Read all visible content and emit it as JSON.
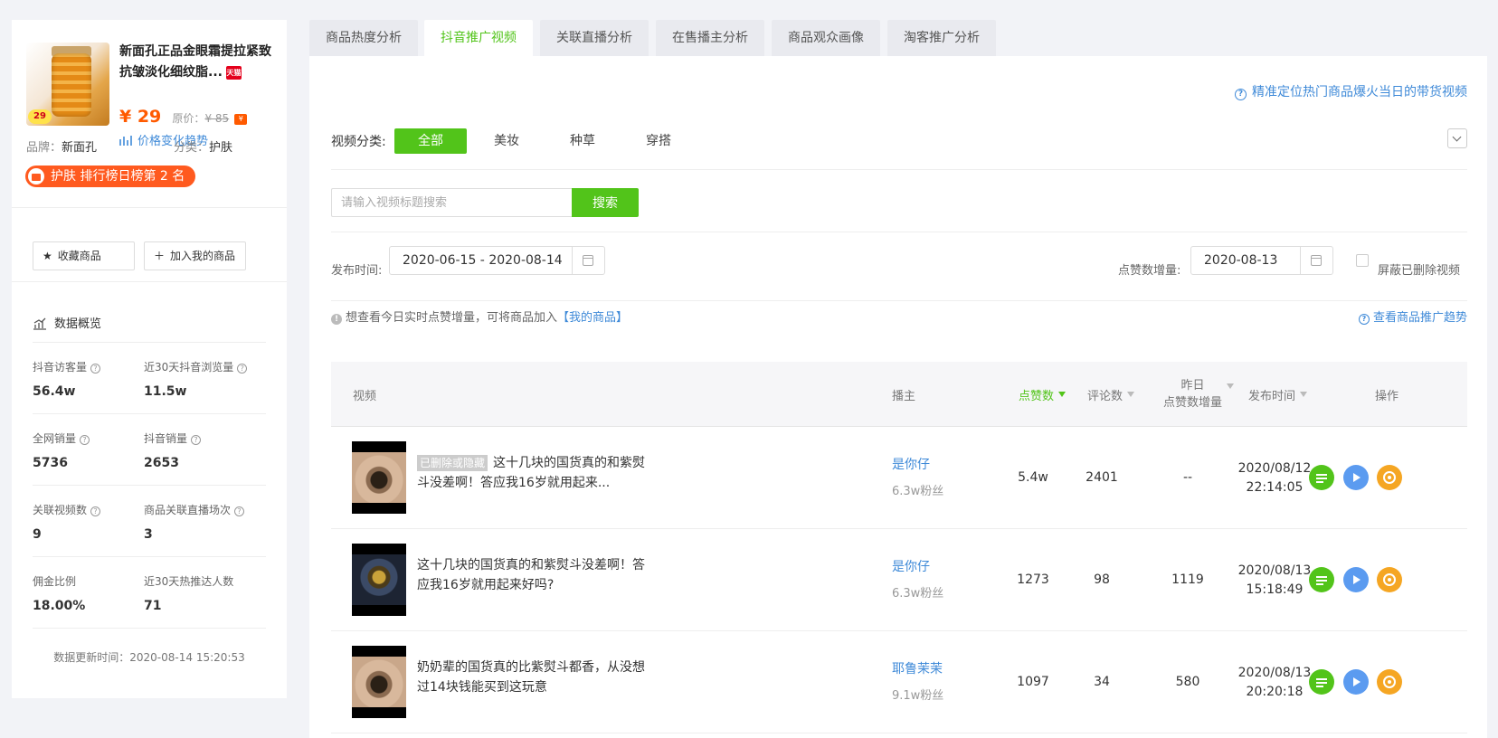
{
  "product": {
    "title": "新面孔正品金眼霜提拉紧致抗皱淡化细纹脂...",
    "tmall_tag": "天猫",
    "price": "¥ 29",
    "orig_price_label": "原价：",
    "orig_price": "¥ 85",
    "small_tag": "¥",
    "image_badge": "29",
    "price_trend_label": "价格变化趋势",
    "brand_label": "品牌：",
    "brand": "新面孔",
    "category_label": "分类：",
    "category": "护肤",
    "rank_badge": "护肤 排行榜日榜第 2 名"
  },
  "actions": {
    "favorite": "收藏商品",
    "add_mine": "加入我的商品"
  },
  "overview": {
    "title": "数据概览",
    "stats": [
      {
        "label": "抖音访客量",
        "value": "56.4w"
      },
      {
        "label": "近30天抖音浏览量",
        "value": "11.5w"
      },
      {
        "label": "全网销量",
        "value": "5736"
      },
      {
        "label": "抖音销量",
        "value": "2653"
      },
      {
        "label": "关联视频数",
        "value": "9"
      },
      {
        "label": "商品关联直播场次",
        "value": "3"
      },
      {
        "label": "佣金比例",
        "value": "18.00%"
      },
      {
        "label": "近30天热推达人数",
        "value": "71"
      }
    ],
    "update_time": "数据更新时间：2020-08-14 15:20:53"
  },
  "tabs": [
    "商品热度分析",
    "抖音推广视频",
    "关联直播分析",
    "在售播主分析",
    "商品观众画像",
    "淘客推广分析"
  ],
  "top_link": "精准定位热门商品爆火当日的带货视频",
  "category_filter": {
    "label": "视频分类:",
    "options": [
      "全部",
      "美妆",
      "种草",
      "穿搭"
    ]
  },
  "search": {
    "placeholder": "请输入视频标题搜索",
    "button": "搜索"
  },
  "filters": {
    "publish_label": "发布时间:",
    "publish_range": "2020-06-15 - 2020-08-14",
    "likes_label": "点赞数增量:",
    "likes_date": "2020-08-13",
    "hide_deleted": "屏蔽已删除视频"
  },
  "hint": {
    "text": "想查看今日实时点赞增量，可将商品加入",
    "link": "【我的商品】",
    "trend_link": "查看商品推广趋势"
  },
  "table": {
    "headers": {
      "video": "视频",
      "anchor": "播主",
      "likes": "点赞数",
      "comments": "评论数",
      "yesterday_1": "昨日",
      "yesterday_2": "点赞数增量",
      "publish_time": "发布时间",
      "ops": "操作"
    },
    "rows": [
      {
        "tag": "已删除或隐藏",
        "title": "这十几块的国货真的和紫熨斗没差啊！答应我16岁就用起来...",
        "anchor": "是你仔",
        "fans": "6.3w粉丝",
        "likes": "5.4w",
        "comments": "2401",
        "yesterday": "--",
        "date": "2020/08/12",
        "time": "22:14:05"
      },
      {
        "tag": "",
        "title": "这十几块的国货真的和紫熨斗没差啊！答应我16岁就用起来好吗?",
        "anchor": "是你仔",
        "fans": "6.3w粉丝",
        "likes": "1273",
        "comments": "98",
        "yesterday": "1119",
        "date": "2020/08/13",
        "time": "15:18:49"
      },
      {
        "tag": "",
        "title": "奶奶辈的国货真的比紫熨斗都香，从没想过14块钱能买到这玩意",
        "anchor": "耶鲁茉茉",
        "fans": "9.1w粉丝",
        "likes": "1097",
        "comments": "34",
        "yesterday": "580",
        "date": "2020/08/13",
        "time": "20:20:18"
      }
    ]
  }
}
